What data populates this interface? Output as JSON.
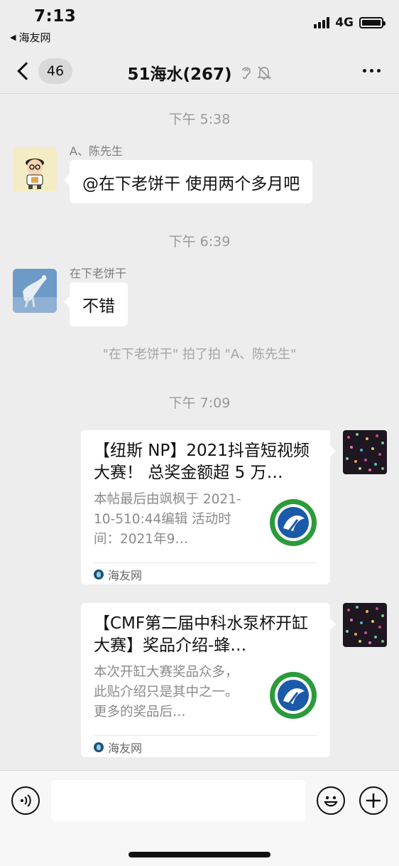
{
  "status_bar": {
    "time": "7:13",
    "back_app": "海友网",
    "network": "4G"
  },
  "nav": {
    "unread_count": "46",
    "title": "51海水(267)"
  },
  "chat": {
    "time_1": "下午 5:38",
    "msg_1": {
      "sender": "A、陈先生",
      "text": "@在下老饼干 使用两个多月吧"
    },
    "time_2": "下午 6:39",
    "msg_2": {
      "sender": "在下老饼干",
      "text": "不错"
    },
    "system_notice": "\"在下老饼干\" 拍了拍 \"A、陈先生\"",
    "time_3": "下午 7:09",
    "cards": [
      {
        "title": "【纽斯 NP】2021抖音短视频大赛！ 总奖金额超 5 万…",
        "description": "本帖最后由飒枫于 2021-10-510:44编辑 活动时间：2021年9…",
        "source": "海友网"
      },
      {
        "title": "【CMF第二届中科水泵杯开缸大赛】奖品介绍-蜂…",
        "description": "本次开缸大赛奖品众多，此贴介绍只是其中之一。更多的奖品后…",
        "source": "海友网"
      }
    ]
  },
  "icons": {
    "back": "chevron-left-icon",
    "earpiece": "ear-icon",
    "mute": "bell-off-icon",
    "more": "more-icon",
    "voice": "voice-icon",
    "emoji": "emoji-icon",
    "add": "plus-icon"
  },
  "colors": {
    "background": "#ededed",
    "bubble": "#ffffff",
    "meta_text": "#9a9a9a"
  }
}
